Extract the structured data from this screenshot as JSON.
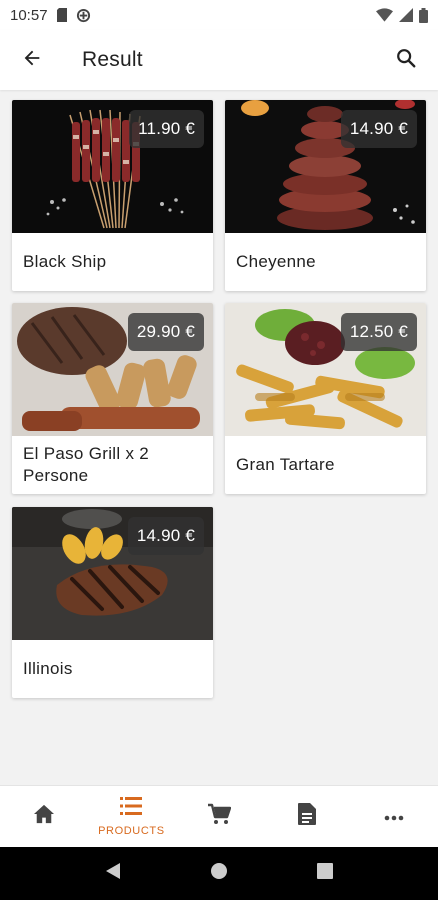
{
  "status_bar": {
    "time": "10:57",
    "icons": [
      "sd-card-icon",
      "data-saver-icon",
      "wifi-icon",
      "signal-icon",
      "battery-icon"
    ]
  },
  "app_bar": {
    "title": "Result",
    "back_icon": "arrow-back-icon",
    "search_icon": "search-icon"
  },
  "products": [
    {
      "name": "Black Ship",
      "price": "11.90 €",
      "image": "skewers-photo"
    },
    {
      "name": "Cheyenne",
      "price": "14.90 €",
      "image": "sliced-steak-photo"
    },
    {
      "name": "El Paso Grill  x 2 Persone",
      "price": "29.90 €",
      "image": "mixed-grill-photo"
    },
    {
      "name": "Gran Tartare",
      "price": "12.50 €",
      "image": "tartare-fries-photo"
    },
    {
      "name": "Illinois",
      "price": "14.90 €",
      "image": "grilled-steak-photo"
    }
  ],
  "bottom_nav": {
    "items": [
      {
        "icon": "home-icon",
        "label": ""
      },
      {
        "icon": "list-icon",
        "label": "PRODUCTS",
        "active": true
      },
      {
        "icon": "cart-icon",
        "label": ""
      },
      {
        "icon": "document-icon",
        "label": ""
      },
      {
        "icon": "more-icon",
        "label": ""
      }
    ],
    "accent_color": "#d86a1f"
  },
  "system_nav": {
    "icons": [
      "back-triangle-icon",
      "home-circle-icon",
      "recents-square-icon"
    ]
  }
}
